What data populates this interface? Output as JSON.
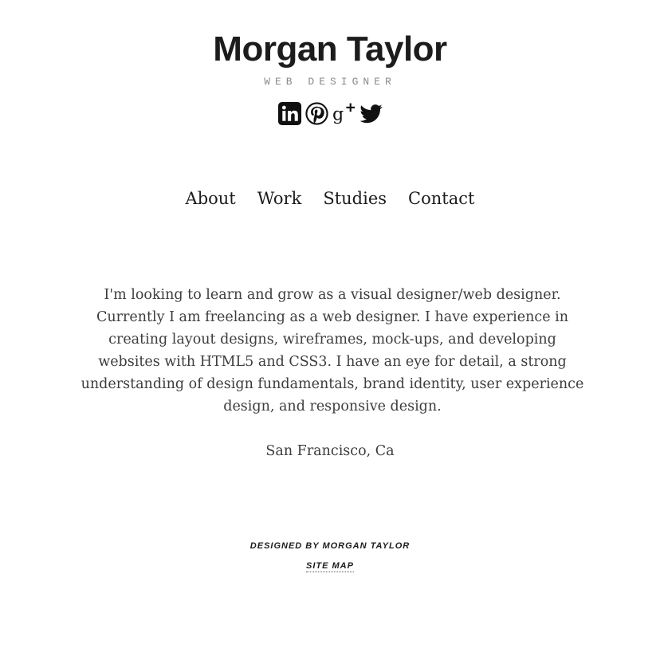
{
  "header": {
    "name": "Morgan Taylor",
    "role": "WEB DESIGNER"
  },
  "social": [
    {
      "icon": "linkedin-icon",
      "label": "LinkedIn"
    },
    {
      "icon": "pinterest-icon",
      "label": "Pinterest"
    },
    {
      "icon": "google-plus-icon",
      "label": "Google+"
    },
    {
      "icon": "twitter-icon",
      "label": "Twitter"
    }
  ],
  "nav": {
    "items": [
      {
        "label": "About"
      },
      {
        "label": "Work"
      },
      {
        "label": "Studies"
      },
      {
        "label": "Contact"
      }
    ]
  },
  "main": {
    "bio": "I'm looking to learn and grow as a visual designer/web designer. Currently I am freelancing as a web designer. I have experience in creating layout designs, wireframes, mock-ups, and developing websites with HTML5 and CSS3. I have an eye for detail, a strong understanding of design fundamentals, brand identity, user experience design, and responsive design.",
    "location": "San Francisco, Ca"
  },
  "footer": {
    "credit": "DESIGNED BY MORGAN TAYLOR",
    "sitemap_label": "SITE MAP"
  },
  "colors": {
    "text": "#1c1c1c",
    "body_text": "#3d3d3d",
    "subtitle": "#8a8a8a",
    "background": "#ffffff"
  }
}
